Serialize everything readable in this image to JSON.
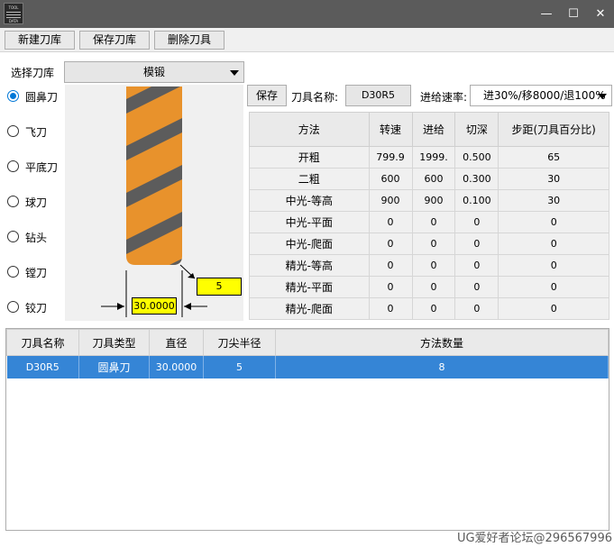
{
  "window": {
    "icon_text_top": "TOOL",
    "icon_text_bottom": "DATA",
    "minimize_glyph": "—",
    "maximize_glyph": "☐",
    "close_glyph": "✕"
  },
  "toolbar": {
    "new_library": "新建刀库",
    "save_library": "保存刀库",
    "delete_tool": "删除刀具"
  },
  "library": {
    "label": "选择刀库",
    "selected": "模锻"
  },
  "tool_types": [
    {
      "label": "圆鼻刀",
      "checked": true
    },
    {
      "label": "飞刀",
      "checked": false
    },
    {
      "label": "平底刀",
      "checked": false
    },
    {
      "label": "球刀",
      "checked": false
    },
    {
      "label": "钻头",
      "checked": false
    },
    {
      "label": "镗刀",
      "checked": false
    },
    {
      "label": "铰刀",
      "checked": false
    }
  ],
  "preview": {
    "corner_radius": "5",
    "diameter": "30.0000"
  },
  "tool_form": {
    "save_button": "保存",
    "name_label": "刀具名称:",
    "name_value": "D30R5",
    "feed_label": "进给速率:",
    "feed_selected": "进30%/移8000/退100%"
  },
  "methods_table": {
    "headers": [
      "方法",
      "转速",
      "进给",
      "切深",
      "步距(刀具百分比)"
    ],
    "rows": [
      [
        "开粗",
        "799.9",
        "1999.",
        "0.500",
        "65"
      ],
      [
        "二粗",
        "600",
        "600",
        "0.300",
        "30"
      ],
      [
        "中光-等高",
        "900",
        "900",
        "0.100",
        "30"
      ],
      [
        "中光-平面",
        "0",
        "0",
        "0",
        "0"
      ],
      [
        "中光-爬面",
        "0",
        "0",
        "0",
        "0"
      ],
      [
        "精光-等高",
        "0",
        "0",
        "0",
        "0"
      ],
      [
        "精光-平面",
        "0",
        "0",
        "0",
        "0"
      ],
      [
        "精光-爬面",
        "0",
        "0",
        "0",
        "0"
      ]
    ]
  },
  "tools_table": {
    "headers": [
      "刀具名称",
      "刀具类型",
      "直径",
      "刀尖半径",
      "方法数量"
    ],
    "rows": [
      [
        "D30R5",
        "圆鼻刀",
        "30.0000",
        "5",
        "8"
      ]
    ]
  },
  "watermark": "UG爱好者论坛@296567996",
  "colors": {
    "titlebar": "#5b5b5b",
    "selection": "#3585d6",
    "tool_body": "#e8922c",
    "tool_flute": "#5c5c5c",
    "label_box": "#ffff00"
  }
}
